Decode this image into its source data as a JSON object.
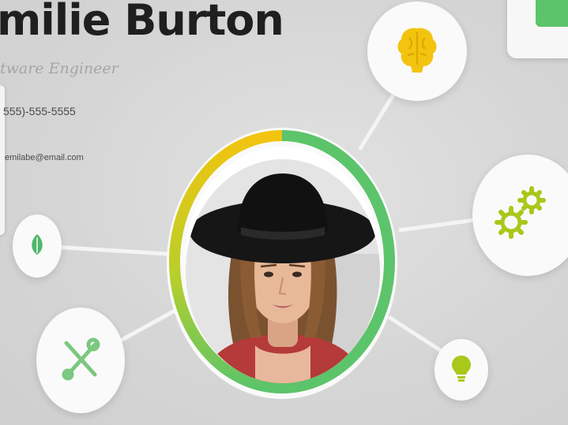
{
  "profile": {
    "name": "milie Burton",
    "role": "tware Engineer",
    "phone": "555)-555-5555",
    "email": "emilabe@email.com"
  },
  "icons": {
    "top": "brain-icon",
    "right": "gears-icon",
    "left_small": "leaf-icon",
    "left_bottom": "tools-icon",
    "right_bottom": "lightbulb-icon"
  },
  "colors": {
    "accent_green": "#5cc46a",
    "accent_yellow": "#f2c40f",
    "text_dark": "#1f1f1f",
    "text_muted": "#a5a5a5"
  }
}
